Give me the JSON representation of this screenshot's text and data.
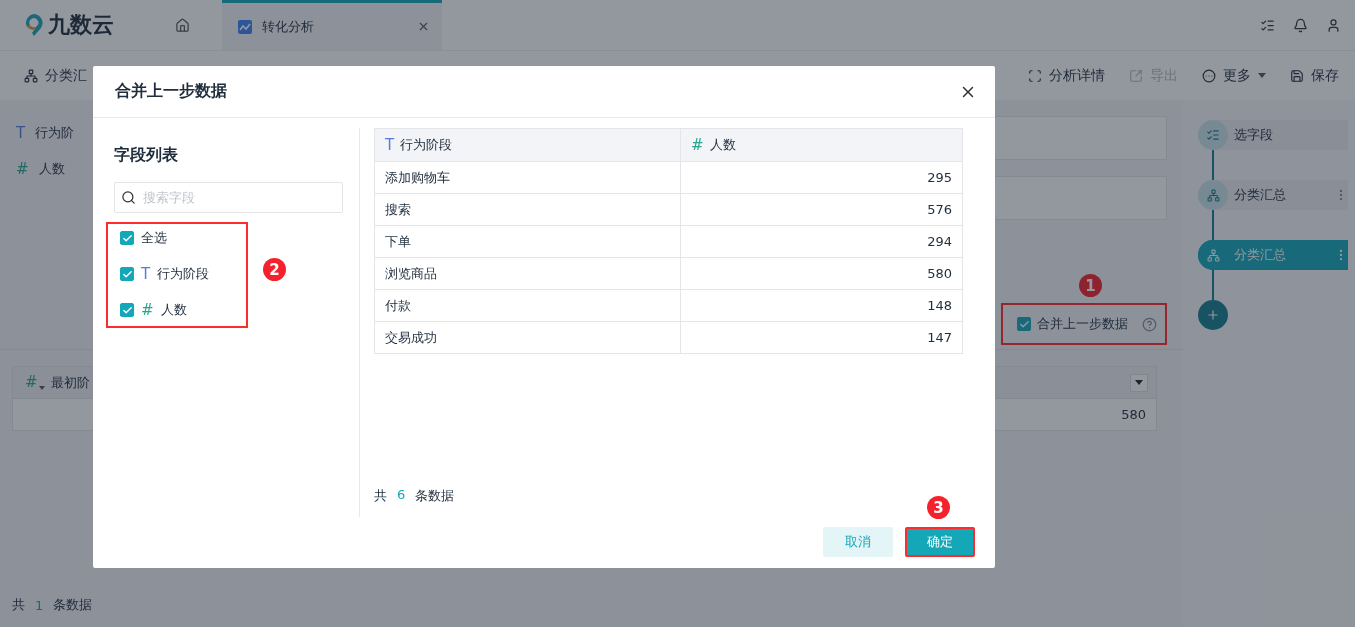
{
  "app": {
    "logo": "九数云",
    "tabs": [
      {
        "label": "转化分析",
        "selected": true
      }
    ]
  },
  "toolbar": [
    {
      "kind": "group",
      "label": "分类汇",
      "disabled": false
    },
    {
      "kind": "detail",
      "label": "分析详情",
      "disabled": false
    },
    {
      "kind": "export",
      "label": "导出",
      "disabled": true
    },
    {
      "kind": "more",
      "label": "更多",
      "disabled": false
    },
    {
      "kind": "save",
      "label": "保存",
      "disabled": false
    }
  ],
  "fields": [
    {
      "kind": "text",
      "icon": "T",
      "name": "行为阶"
    },
    {
      "kind": "number",
      "icon": "#",
      "name": "人数"
    }
  ],
  "merge_option": {
    "label": "合并上一步数据",
    "checked": true,
    "badge": "1"
  },
  "result_table": {
    "column_icon": "#",
    "column": "最初阶",
    "rows": [
      "580"
    ]
  },
  "footer": {
    "prefix": "共",
    "count": "1",
    "suffix": "条数据"
  },
  "steps": [
    {
      "kind": "select",
      "label": "选字段",
      "selected": false,
      "menu": false
    },
    {
      "kind": "group",
      "label": "分类汇总",
      "selected": false,
      "menu": true
    },
    {
      "kind": "group",
      "label": "分类汇总",
      "selected": true,
      "menu": true
    }
  ],
  "dialog": {
    "title": "合并上一步数据",
    "field_list": {
      "title": "字段列表",
      "search_placeholder": "搜索字段",
      "badge": "2",
      "items": [
        {
          "label": "全选",
          "checked": true
        },
        {
          "kind": "text",
          "icon": "T",
          "label": "行为阶段",
          "checked": true
        },
        {
          "kind": "number",
          "icon": "#",
          "label": "人数",
          "checked": true
        }
      ]
    },
    "preview": {
      "columns": [
        {
          "kind": "text",
          "icon": "T",
          "label": "行为阶段"
        },
        {
          "kind": "number",
          "icon": "#",
          "label": "人数"
        }
      ],
      "rows": [
        [
          "添加购物车",
          "295"
        ],
        [
          "搜索",
          "576"
        ],
        [
          "下单",
          "294"
        ],
        [
          "浏览商品",
          "580"
        ],
        [
          "付款",
          "148"
        ],
        [
          "交易成功",
          "147"
        ]
      ]
    },
    "summary": {
      "prefix": "共",
      "count": "6",
      "suffix": "条数据"
    },
    "buttons": [
      {
        "kind": "cancel",
        "label": "取消"
      },
      {
        "kind": "confirm",
        "label": "确定",
        "badge": "3"
      }
    ]
  }
}
